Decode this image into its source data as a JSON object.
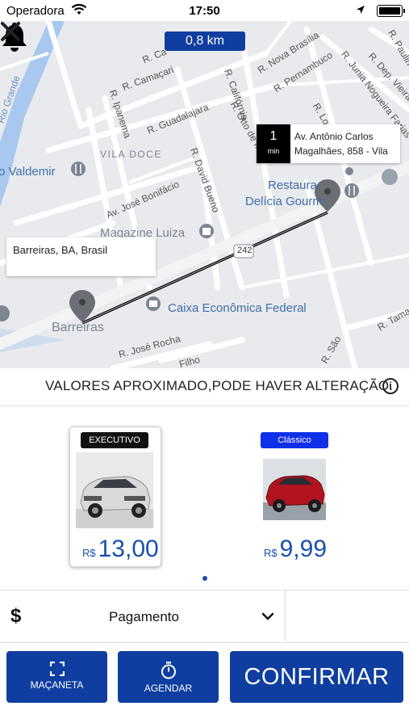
{
  "status_bar": {
    "carrier": "Operadora",
    "time": "17:50"
  },
  "map": {
    "distance": "0,8 km",
    "destination": {
      "minutes": "1",
      "unit": "min",
      "address_line1": "Av. Antônio Carlos",
      "address_line2": "Magalhães, 858 - Vila"
    },
    "origin": {
      "address": "Barreiras, BA, Brasil"
    },
    "labels": {
      "vila_doce": "VILA DOCE",
      "valdemir": "o Valdemir",
      "restaurante": "Restaura",
      "delicia": "Delícia Gourm",
      "magazine": "Magazine Luiza",
      "caixa": "Caixa Econômica Federal",
      "barreiras": "Barreiras",
      "rio_grande": "Rio Grande",
      "jose_bonifacio": "Av. José Bonifácio",
      "jose_rocha": "R. José Rocha",
      "filho": "Filho",
      "ipanema": "R. Ipanema",
      "camacari": "R. Camaçari",
      "guadalajara": "R. Guadalajara",
      "california": "R. Califórnia",
      "otto": "R. Otto de Mo",
      "david_bueno": "R. David Bueno",
      "nova_brasilia": "R. Nova Brasília",
      "pernambuco": "R. Pernambuco",
      "junia": "R. Junia Nogueira Farias",
      "dep_vieira": "R. Dep. Vieira de",
      "paulin": "R. Paulin",
      "tama": "R. Tama",
      "sao": "R. São",
      "route_242": "242",
      "rca": "R. Ca",
      "rlo": "R. Lo"
    }
  },
  "notice": {
    "text": "VALORES APROXIMADO,PODE HAVER ALTERAÇÃO.",
    "info": "i"
  },
  "options": [
    {
      "category": "EXECUTIVO",
      "currency": "R$",
      "price": "13,00",
      "selected": true
    },
    {
      "category": "Clássico",
      "currency": "R$",
      "price": "9,99",
      "selected": false
    }
  ],
  "payment": {
    "symbol": "$",
    "label": "Pagamento"
  },
  "buttons": {
    "macaneta": "MAÇANETA",
    "agendar": "AGENDAR",
    "confirmar": "CONFIRMAR"
  },
  "colors": {
    "primary": "#0f3ea0",
    "price": "#1a4fb0",
    "classic_tag": "#0f2fe8"
  }
}
